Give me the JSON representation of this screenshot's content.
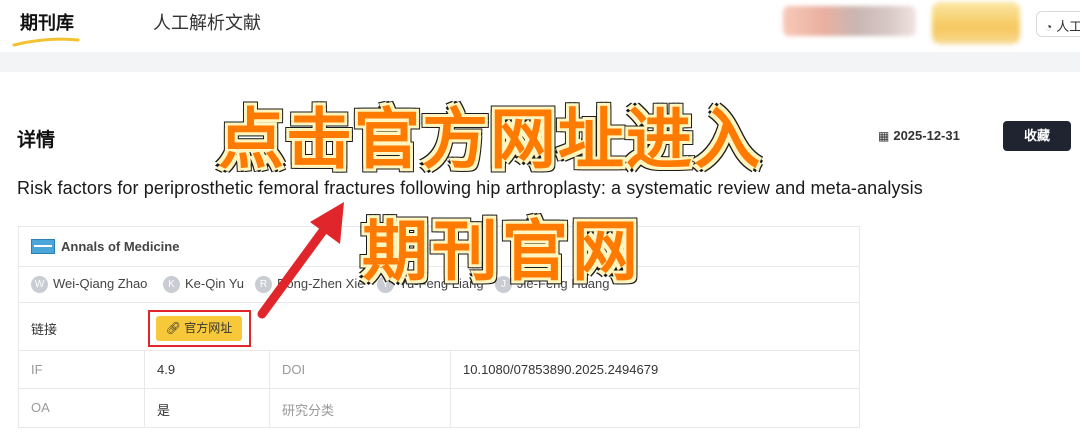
{
  "nav": {
    "tabs": [
      {
        "label": "期刊库",
        "active": true
      },
      {
        "label": "人工解析文献",
        "active": false
      }
    ],
    "user_button_label": "人工",
    "user_icon": "headset-icon"
  },
  "detail": {
    "section_title": "详情",
    "date": "2025-12-31",
    "date_icon": "calendar-icon",
    "favorite_label": "收藏",
    "paper_title": "Risk factors for periprosthetic femoral fractures following hip arthroplasty: a systematic review and meta-analysis",
    "journal": "Annals of Medicine",
    "authors": [
      {
        "initial": "W",
        "name": "Wei-Qiang Zhao"
      },
      {
        "initial": "K",
        "name": "Ke-Qin Yu"
      },
      {
        "initial": "R",
        "name": "Rong-Zhen Xie"
      },
      {
        "initial": "Y",
        "name": "Yu-Feng Liang"
      },
      {
        "initial": "J",
        "name": "Jie-Feng Huang"
      }
    ],
    "link_label": "链接",
    "official_site_label": "官方网址",
    "link_icon": "link-icon",
    "rows": [
      {
        "k1": "IF",
        "v1": "4.9",
        "k2": "DOI",
        "v2": "10.1080/07853890.2025.2494679"
      },
      {
        "k1": "OA",
        "v1": "是",
        "k2": "研究分类",
        "v2": ""
      }
    ]
  },
  "annotation": {
    "line1": "点击官方网址进入",
    "line2": "期刊官网",
    "text_color": "#ff7a00",
    "arrow_color": "#e0262b"
  }
}
